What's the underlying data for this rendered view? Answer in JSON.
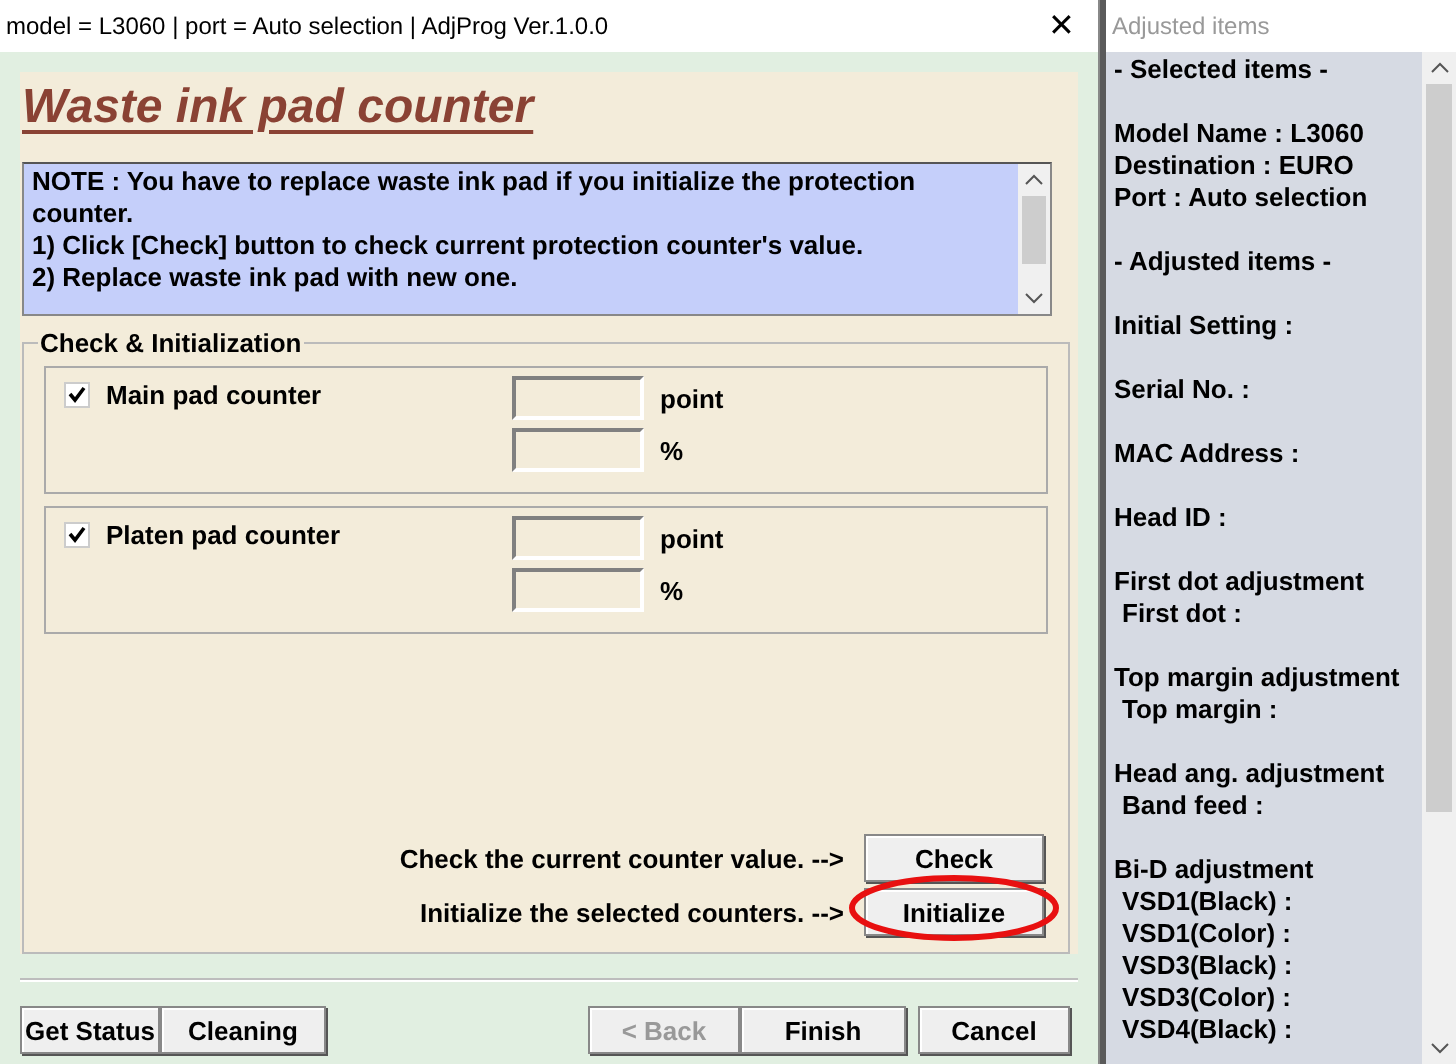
{
  "window": {
    "title": "model = L3060 | port = Auto selection | AdjProg Ver.1.0.0",
    "close": "✕"
  },
  "heading": "Waste ink pad counter",
  "note": [
    "NOTE : You have to replace waste ink pad if you initialize the protection counter.",
    "1) Click [Check] button to check current protection counter's value.",
    "2) Replace waste ink pad with new one."
  ],
  "group": {
    "title": "Check & Initialization",
    "counters": [
      {
        "label": "Main pad counter",
        "checked": true,
        "units": [
          "point",
          "%"
        ]
      },
      {
        "label": "Platen pad counter",
        "checked": true,
        "units": [
          "point",
          "%"
        ]
      }
    ],
    "actions": [
      {
        "text": "Check the current counter value. -->",
        "button": "Check",
        "highlighted": false
      },
      {
        "text": "Initialize the selected counters. -->",
        "button": "Initialize",
        "highlighted": true
      }
    ]
  },
  "buttons": [
    [
      {
        "label": "Get Status",
        "disabled": false
      },
      {
        "label": "Cleaning",
        "disabled": false
      }
    ],
    [
      {
        "label": "< Back",
        "disabled": true
      },
      {
        "label": "Finish",
        "disabled": false
      }
    ],
    [
      {
        "label": "Cancel",
        "disabled": false
      }
    ]
  ],
  "side_panel": {
    "title": "Adjusted items",
    "sections": [
      [
        {
          "text": "- Selected items -",
          "indented": false
        }
      ],
      [
        {
          "text": "Model Name : L3060",
          "indented": false
        },
        {
          "text": "Destination : EURO",
          "indented": false
        },
        {
          "text": "Port : Auto selection",
          "indented": false
        }
      ],
      [
        {
          "text": "- Adjusted items -",
          "indented": false
        }
      ],
      [
        {
          "text": "Initial Setting :",
          "indented": false
        }
      ],
      [
        {
          "text": "Serial No. :",
          "indented": false
        }
      ],
      [
        {
          "text": "MAC Address :",
          "indented": false
        }
      ],
      [
        {
          "text": "Head ID :",
          "indented": false
        }
      ],
      [
        {
          "text": "First dot adjustment",
          "indented": false
        },
        {
          "text": "First dot :",
          "indented": true
        }
      ],
      [
        {
          "text": "Top margin adjustment",
          "indented": false
        },
        {
          "text": "Top margin :",
          "indented": true
        }
      ],
      [
        {
          "text": "Head ang. adjustment",
          "indented": false
        },
        {
          "text": "Band feed :",
          "indented": true
        }
      ],
      [
        {
          "text": "Bi-D adjustment",
          "indented": false
        },
        {
          "text": "VSD1(Black) :",
          "indented": true
        },
        {
          "text": "VSD1(Color) :",
          "indented": true
        },
        {
          "text": "VSD3(Black) :",
          "indented": true
        },
        {
          "text": "VSD3(Color) :",
          "indented": true
        },
        {
          "text": "VSD4(Black) :",
          "indented": true
        }
      ]
    ]
  }
}
